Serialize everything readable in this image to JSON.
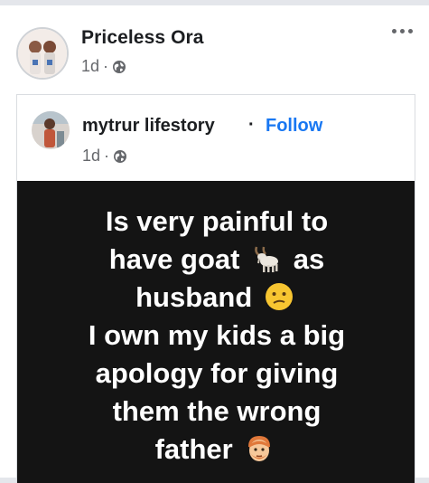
{
  "post": {
    "author": "Priceless Ora",
    "time": "1d",
    "separator": "·"
  },
  "shared": {
    "author": "mytrur lifestory",
    "dot": "·",
    "follow_label": "Follow",
    "time": "1d",
    "separator": "·",
    "caption_lines": [
      [
        "Is very painful to"
      ],
      [
        "have goat ",
        "goat-emoji",
        " as"
      ],
      [
        "husband ",
        "confused-face-emoji"
      ],
      [
        "I own my kids a big"
      ],
      [
        "apology for giving"
      ],
      [
        "them the wrong"
      ],
      [
        "father ",
        "man-face-emoji"
      ]
    ],
    "line1": "Is very painful to",
    "line2a": "have goat",
    "line2b": "as",
    "line3": "husband",
    "line4": "I own my kids a big",
    "line5": "apology for giving",
    "line6": "them the wrong",
    "line7": "father"
  },
  "icons": {
    "audience": "globe-icon",
    "menu": "more-options-icon"
  },
  "colors": {
    "link": "#1877f2",
    "image_bg": "#141414",
    "text": "#1c1e21",
    "muted": "#65676b"
  }
}
